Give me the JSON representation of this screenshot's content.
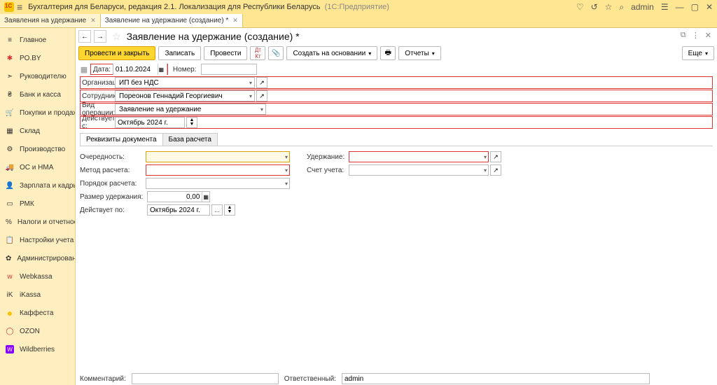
{
  "title": {
    "app": "Бухгалтерия для Беларуси, редакция 2.1. Локализация для Республики Беларусь",
    "mode": "(1С:Предприятие)",
    "user": "admin"
  },
  "tabs": [
    {
      "label": "Заявления на удержание"
    },
    {
      "label": "Заявление на удержание (создание) *"
    }
  ],
  "sidebar": {
    "items": [
      {
        "label": "Главное",
        "icon": "≡"
      },
      {
        "label": "PO.BY",
        "icon": "✱",
        "color": "#d33"
      },
      {
        "label": "Руководителю",
        "icon": "➣"
      },
      {
        "label": "Банк и касса",
        "icon": "₴"
      },
      {
        "label": "Покупки и продажи",
        "icon": "🛒"
      },
      {
        "label": "Склад",
        "icon": "▦"
      },
      {
        "label": "Производство",
        "icon": "⚙"
      },
      {
        "label": "ОС и НМА",
        "icon": "🚚"
      },
      {
        "label": "Зарплата и кадры",
        "icon": "👤"
      },
      {
        "label": "РМК",
        "icon": "▭"
      },
      {
        "label": "Налоги и отчетность",
        "icon": "%"
      },
      {
        "label": "Настройки учета",
        "icon": "📋"
      },
      {
        "label": "Администрирование",
        "icon": "✿"
      },
      {
        "label": "Webkassa",
        "icon": "w",
        "color": "#d33"
      },
      {
        "label": "iKassa",
        "icon": "iK"
      },
      {
        "label": "Каффеста",
        "icon": "●",
        "color": "#f5c400"
      },
      {
        "label": "OZON",
        "icon": "◯",
        "color": "#d33"
      },
      {
        "label": "Wildberries",
        "icon": "W",
        "color": "#80f"
      }
    ]
  },
  "doc": {
    "title": "Заявление на удержание (создание) *",
    "toolbar": {
      "post_close": "Провести и закрыть",
      "save": "Записать",
      "post": "Провести",
      "create_based": "Создать на основании",
      "reports": "Отчеты",
      "more": "Еще"
    },
    "date_lbl": "Дата:",
    "date_val": "01.10.2024",
    "num_lbl": "Номер:",
    "num_val": "",
    "org_lbl": "Организация:",
    "org_val": "ИП без НДС",
    "emp_lbl": "Сотрудник:",
    "emp_val": "Пореонов Геннадий Георгиевич",
    "optype_lbl": "Вид операции:",
    "optype_val": "Заявление на удержание",
    "eff_lbl": "Действует с:",
    "eff_val": "Октябрь 2024 г.",
    "ftabs": {
      "a": "Реквизиты документа",
      "b": "База расчета"
    },
    "left": {
      "priority_lbl": "Очередность:",
      "method_lbl": "Метод расчета:",
      "order_lbl": "Порядок расчета:",
      "amount_lbl": "Размер удержания:",
      "amount_val": "0,00",
      "until_lbl": "Действует по:",
      "until_val": "Октябрь 2024 г."
    },
    "right": {
      "deduction_lbl": "Удержание:",
      "account_lbl": "Счет учета:"
    },
    "footer": {
      "comment_lbl": "Комментарий:",
      "resp_lbl": "Ответственный:",
      "resp_val": "admin"
    }
  }
}
